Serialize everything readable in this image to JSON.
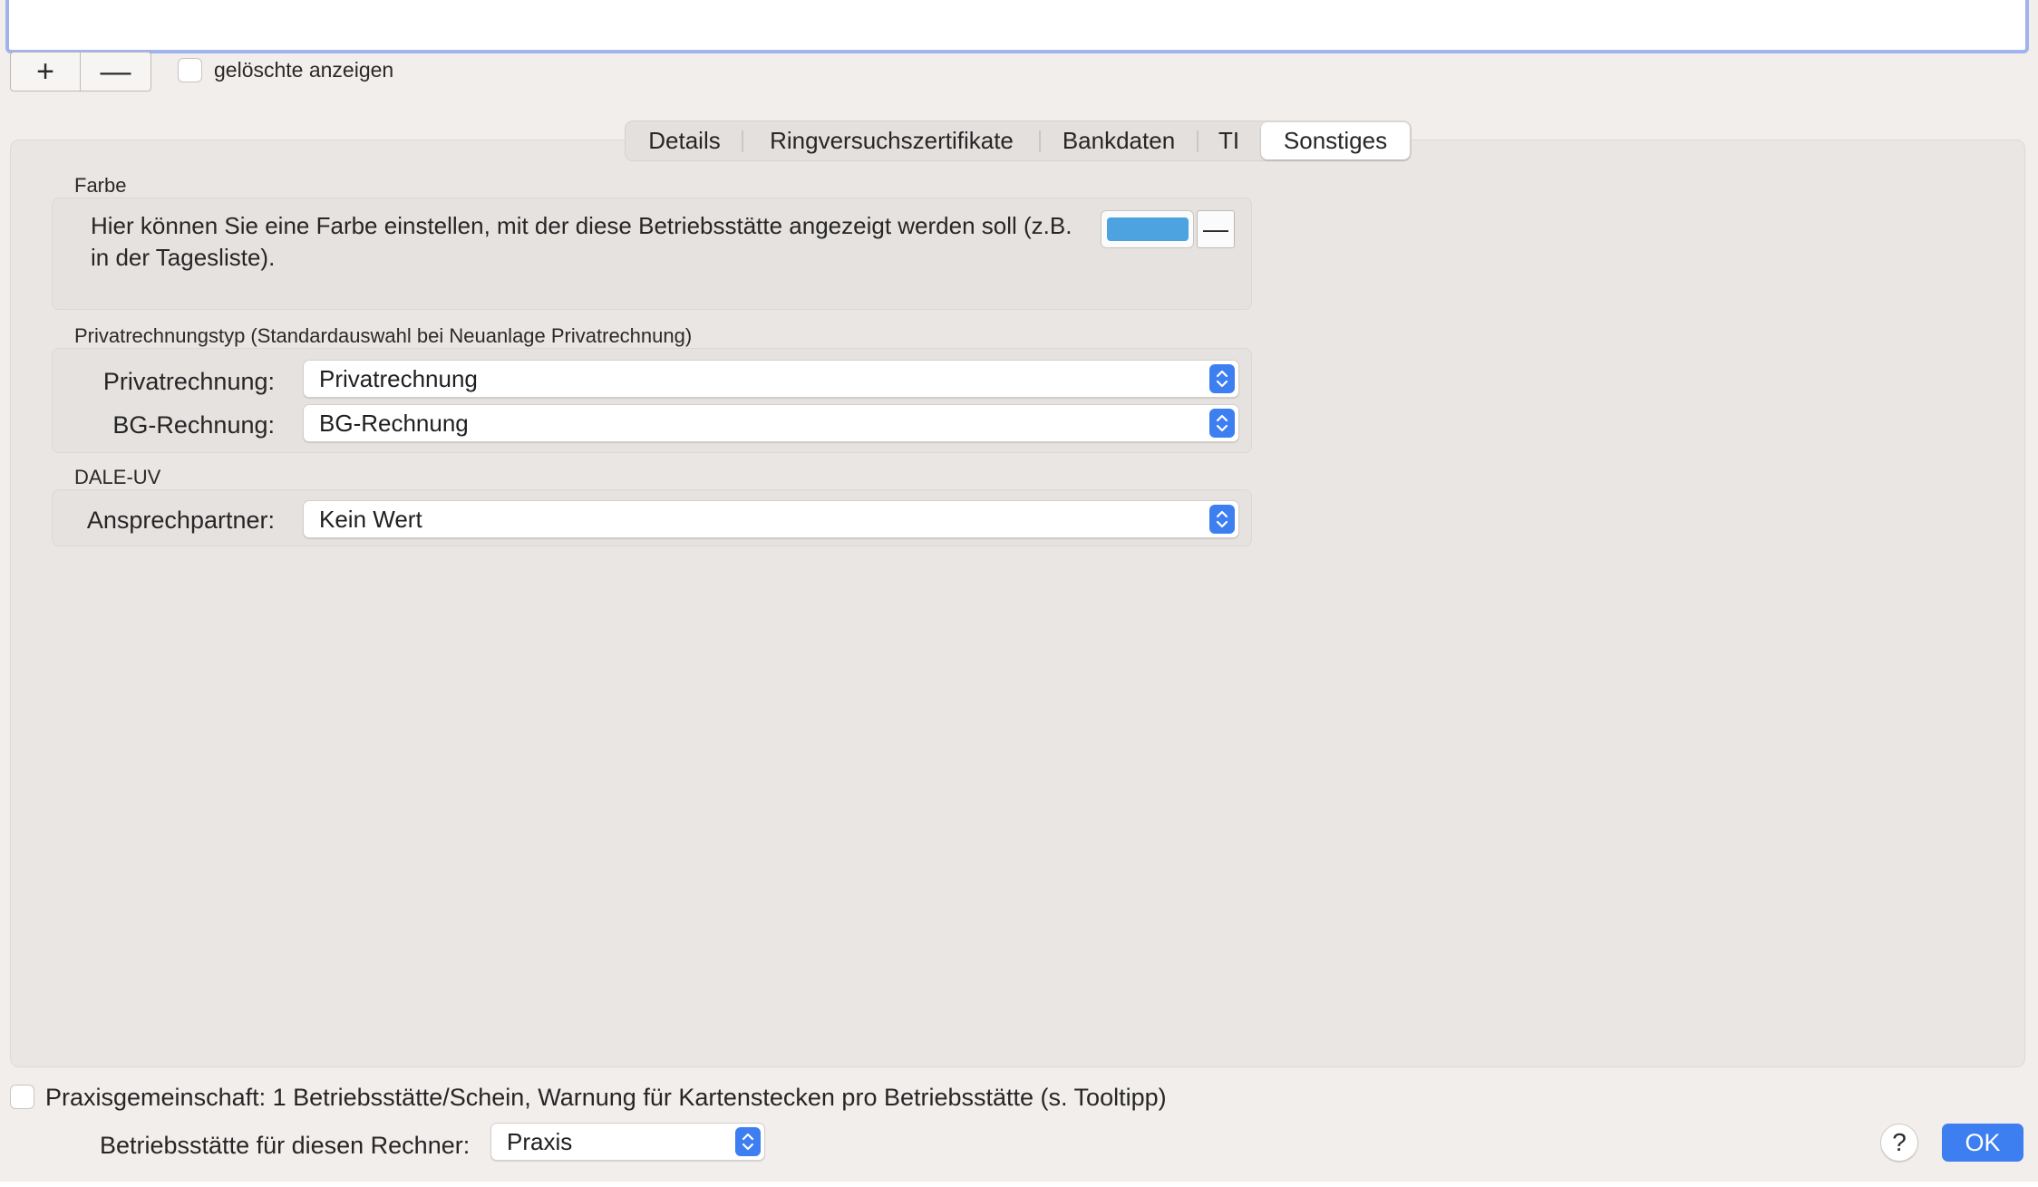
{
  "toolbar": {
    "add_label": "+",
    "remove_label": "—",
    "show_deleted_label": "gelöschte anzeigen"
  },
  "tabs": [
    {
      "label": "Details",
      "selected": false
    },
    {
      "label": "Ringversuchszertifikate",
      "selected": false
    },
    {
      "label": "Bankdaten",
      "selected": false
    },
    {
      "label": "TI",
      "selected": false
    },
    {
      "label": "Sonstiges",
      "selected": true
    }
  ],
  "farbe": {
    "group_title": "Farbe",
    "description": "Hier können Sie eine Farbe einstellen, mit der diese Betriebsstätte angezeigt werden soll (z.B. in der Tagesliste).",
    "color": "#4da3e0",
    "clear_label": "—"
  },
  "privatrechnungstyp": {
    "group_title": "Privatrechnungstyp (Standardauswahl bei Neuanlage Privatrechnung)",
    "privatrechnung_label": "Privatrechnung:",
    "privatrechnung_value": "Privatrechnung",
    "bg_label": "BG-Rechnung:",
    "bg_value": "BG-Rechnung"
  },
  "dale_uv": {
    "group_title": "DALE-UV",
    "ansprechpartner_label": "Ansprechpartner:",
    "ansprechpartner_value": "Kein Wert"
  },
  "bottom": {
    "praxisgemeinschaft_label": "Praxisgemeinschaft: 1 Betriebsstätte/Schein, Warnung für Kartenstecken pro Betriebsstätte (s. Tooltipp)",
    "rechner_label": "Betriebsstätte für diesen Rechner:",
    "rechner_value": "Praxis",
    "help_label": "?",
    "ok_label": "OK"
  },
  "colors": {
    "accent": "#3d7ef0",
    "ok_button": "#3d7ef0"
  }
}
